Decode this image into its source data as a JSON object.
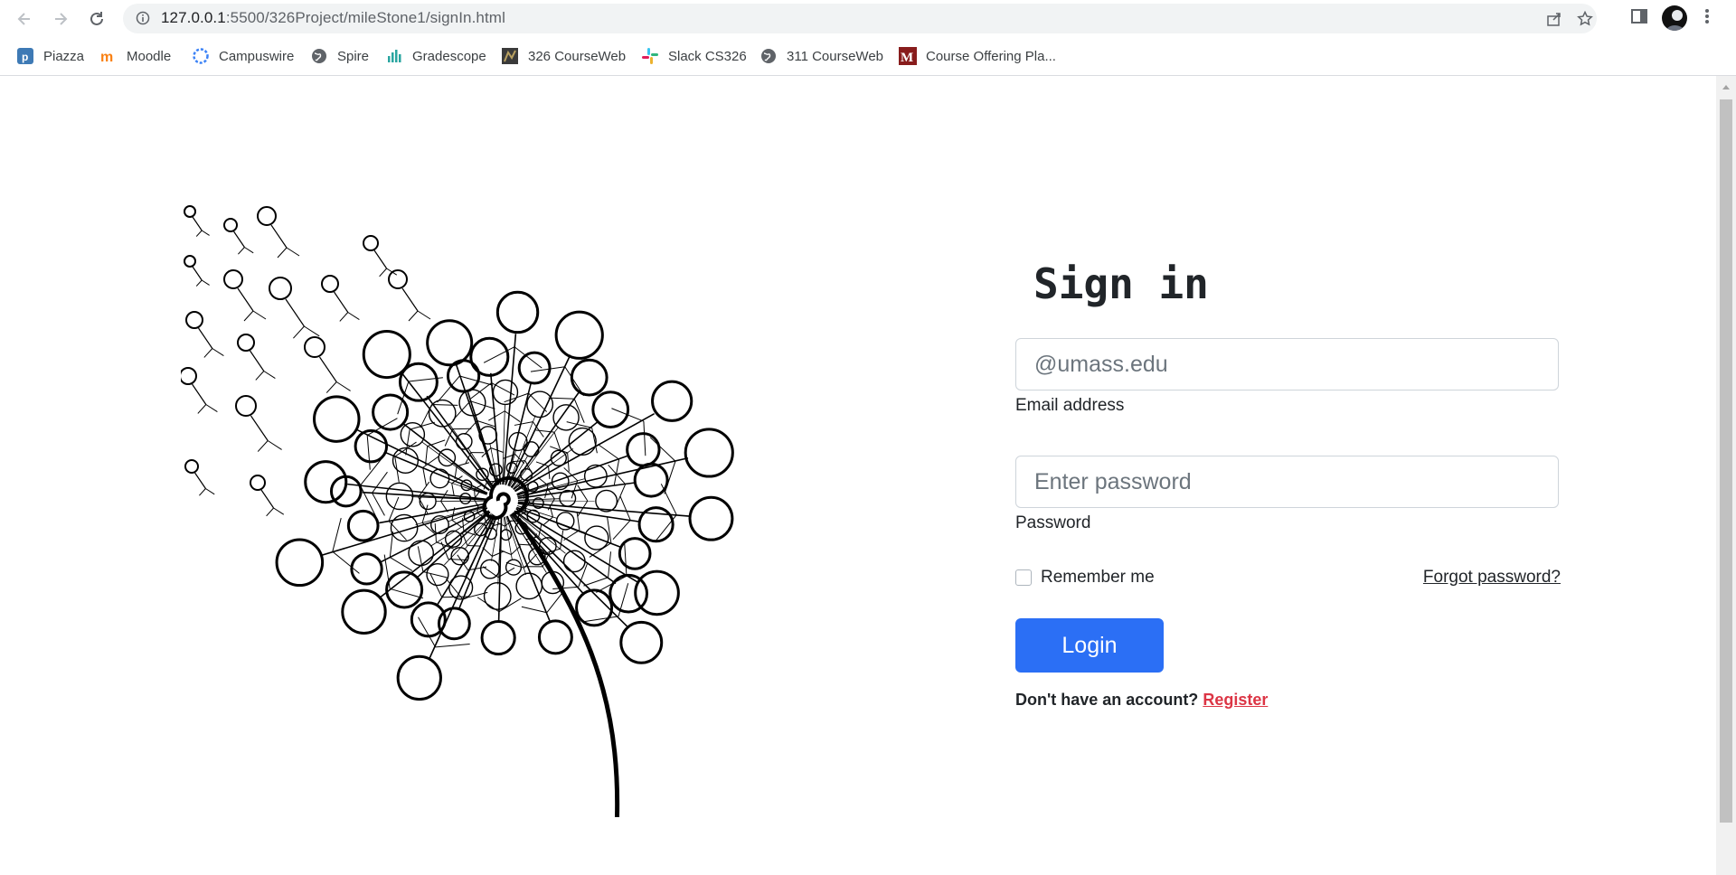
{
  "browser": {
    "url_host": "127.0.0.1",
    "url_path": ":5500/326Project/mileStone1/signIn.html",
    "bookmarks": [
      {
        "label": "Piazza",
        "icon": "piazza-icon",
        "color": "#3e7ab5"
      },
      {
        "label": "Moodle",
        "icon": "moodle-icon",
        "color": "#f98012"
      },
      {
        "label": "Campuswire",
        "icon": "campuswire-icon",
        "color": "#3b82f6"
      },
      {
        "label": "Spire",
        "icon": "globe-icon",
        "color": "#5f6368"
      },
      {
        "label": "Gradescope",
        "icon": "gradescope-icon",
        "color": "#2aa5a0"
      },
      {
        "label": "326 CourseWeb",
        "icon": "courseweb-icon",
        "color": "#444444"
      },
      {
        "label": "Slack CS326",
        "icon": "slack-icon",
        "color": "#e01e5a"
      },
      {
        "label": "311 CourseWeb",
        "icon": "globe-icon",
        "color": "#5f6368"
      },
      {
        "label": "Course Offering Pla...",
        "icon": "umass-icon",
        "color": "#881c1c"
      }
    ]
  },
  "signin": {
    "title": "Sign in",
    "email_placeholder": "@umass.edu",
    "email_label": "Email address",
    "password_placeholder": "Enter password",
    "password_label": "Password",
    "remember_label": "Remember me",
    "forgot_label": "Forgot password?",
    "login_label": "Login",
    "no_account_text": "Don't have an account?",
    "register_label": "Register"
  },
  "colors": {
    "primary": "#2b6ff5",
    "register_link": "#dc3545",
    "text": "#212529"
  }
}
